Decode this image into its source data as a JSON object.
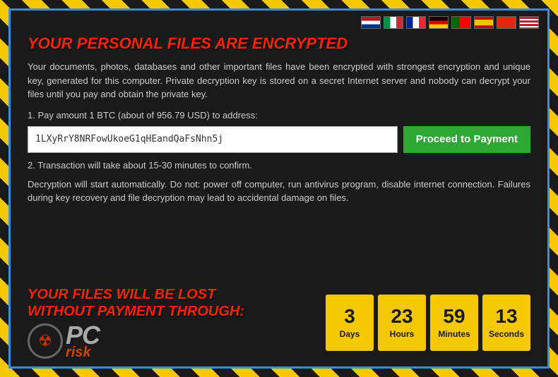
{
  "flags": [
    {
      "name": "netherlands",
      "class": "flag-nl"
    },
    {
      "name": "italy",
      "class": "flag-it"
    },
    {
      "name": "france",
      "class": "flag-fr"
    },
    {
      "name": "germany",
      "class": "flag-de"
    },
    {
      "name": "portugal",
      "class": "flag-pt"
    },
    {
      "name": "spain",
      "class": "flag-es"
    },
    {
      "name": "china",
      "class": "flag-cn"
    },
    {
      "name": "usa",
      "class": "flag-us"
    }
  ],
  "title": "YOUR PERSONAL FILES ARE ENCRYPTED",
  "description": "Your documents, photos, databases and other important files have been encrypted with strongest encryption and unique key, generated for this computer. Private decryption key is stored on a secret Internet server and nobody can decrypt your files until you pay and obtain the private key.",
  "step1_label": "1. Pay amount 1 BTC (about of 956.79 USD) to address:",
  "btc_address": "1LXyRrY8NRFowUkoeG1qHEandQaFsNhn5j",
  "proceed_button": "Proceed to Payment",
  "step2_label": "2. Transaction will take about 15-30 minutes to confirm.",
  "warning_text": "Decryption will start automatically. Do not: power off computer, run antivirus program, disable internet connection. Failures during key recovery and file decryption may lead to accidental damage on files.",
  "lost_warning_line1": "YOUR FILES WILL BE LOST",
  "lost_warning_line2": "WITHOUT PAYMENT THROUGH:",
  "countdown": {
    "days": {
      "value": "3",
      "label": "Days"
    },
    "hours": {
      "value": "23",
      "label": "Hours"
    },
    "minutes": {
      "value": "59",
      "label": "Minutes"
    },
    "seconds": {
      "value": "13",
      "label": "Seconds"
    }
  },
  "logo": {
    "pc_text": "PC",
    "risk_text": "risk",
    "icon": "☢"
  }
}
